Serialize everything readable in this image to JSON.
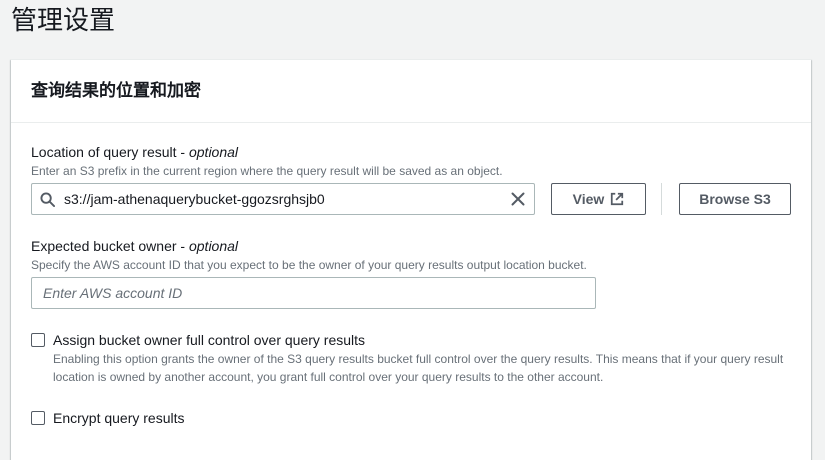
{
  "page": {
    "title": "管理设置"
  },
  "panel": {
    "title": "查询结果的位置和加密",
    "location": {
      "label": "Location of query result - ",
      "label_optional": "optional",
      "description": "Enter an S3 prefix in the current region where the query result will be saved as an object.",
      "value": "s3://jam-athenaquerybucket-ggozsrghsjb0",
      "view_button": "View",
      "browse_button": "Browse S3"
    },
    "owner": {
      "label": "Expected bucket owner - ",
      "label_optional": "optional",
      "description": "Specify the AWS account ID that you expect to be the owner of your query results output location bucket.",
      "placeholder": "Enter AWS account ID"
    },
    "full_control": {
      "label": "Assign bucket owner full control over query results",
      "description": "Enabling this option grants the owner of the S3 query results bucket full control over the query results. This means that if your query result location is owned by another account, you grant full control over your query results to the other account."
    },
    "encrypt": {
      "label": "Encrypt query results"
    }
  },
  "colors": {
    "background": "#f2f3f3",
    "text": "#16191f",
    "secondary_text": "#687078",
    "button_border": "#545b64"
  }
}
